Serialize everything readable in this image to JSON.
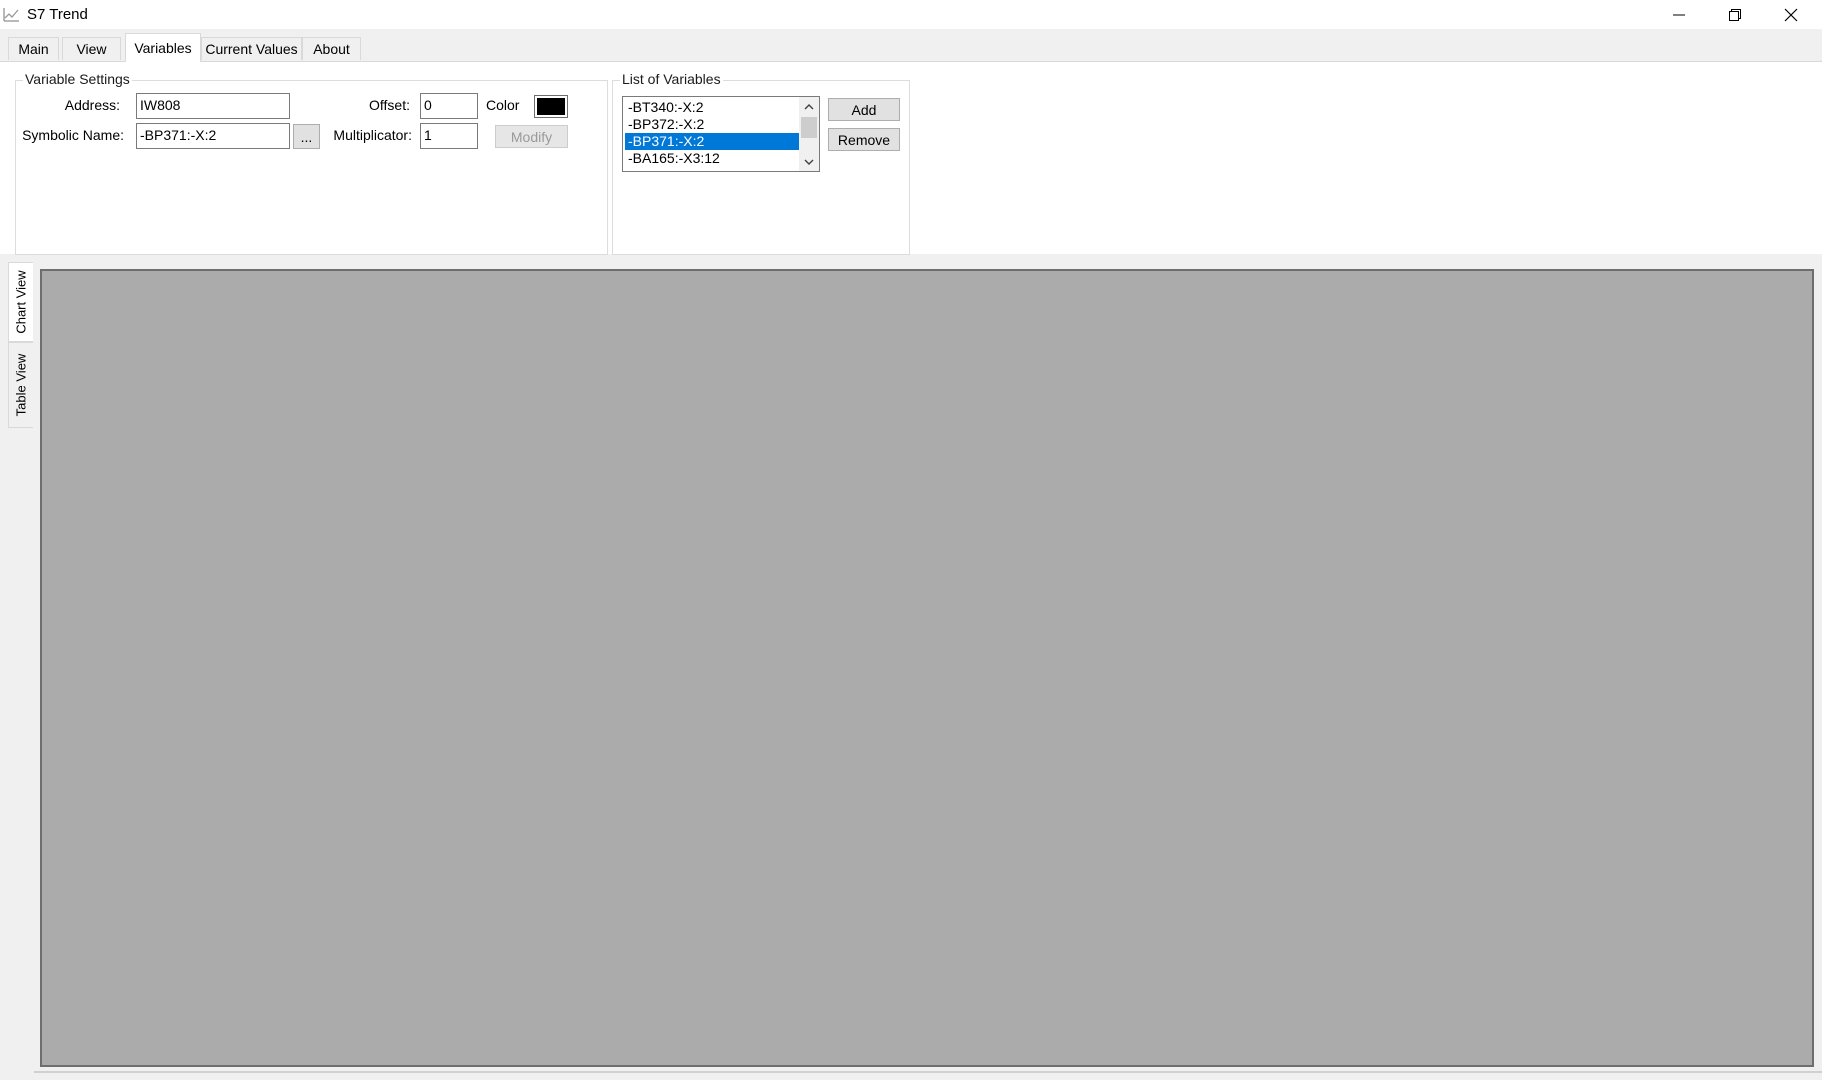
{
  "window": {
    "title": "S7 Trend",
    "icons": {
      "app": "chart-app-icon",
      "minimize": "minimize-icon",
      "restore": "restore-icon",
      "close": "close-icon"
    }
  },
  "tabs": [
    {
      "label": "Main",
      "active": false
    },
    {
      "label": "View",
      "active": false
    },
    {
      "label": "Variables",
      "active": true
    },
    {
      "label": "Current Values",
      "active": false
    },
    {
      "label": "About",
      "active": false
    }
  ],
  "variable_settings": {
    "caption": "Variable Settings",
    "address_label": "Address:",
    "address_value": "IW808",
    "symbolic_name_label": "Symbolic Name:",
    "symbolic_name_value": "-BP371:-X:2",
    "browse_label": "...",
    "offset_label": "Offset:",
    "offset_value": "0",
    "multiplicator_label": "Multiplicator:",
    "multiplicator_value": "1",
    "color_label": "Color",
    "color_value": "#000000",
    "modify_label": "Modify"
  },
  "list_of_variables": {
    "caption": "List of Variables",
    "items": [
      "-BT340:-X:2",
      "-BP372:-X:2",
      "-BP371:-X:2",
      "-BA165:-X3:12"
    ],
    "selected_index": 2,
    "add_label": "Add",
    "remove_label": "Remove"
  },
  "side_tabs": [
    {
      "label": "Chart View",
      "active": true
    },
    {
      "label": "Table View",
      "active": false
    }
  ],
  "colors": {
    "selection": "#0078d7",
    "chart_background": "#ababab"
  }
}
